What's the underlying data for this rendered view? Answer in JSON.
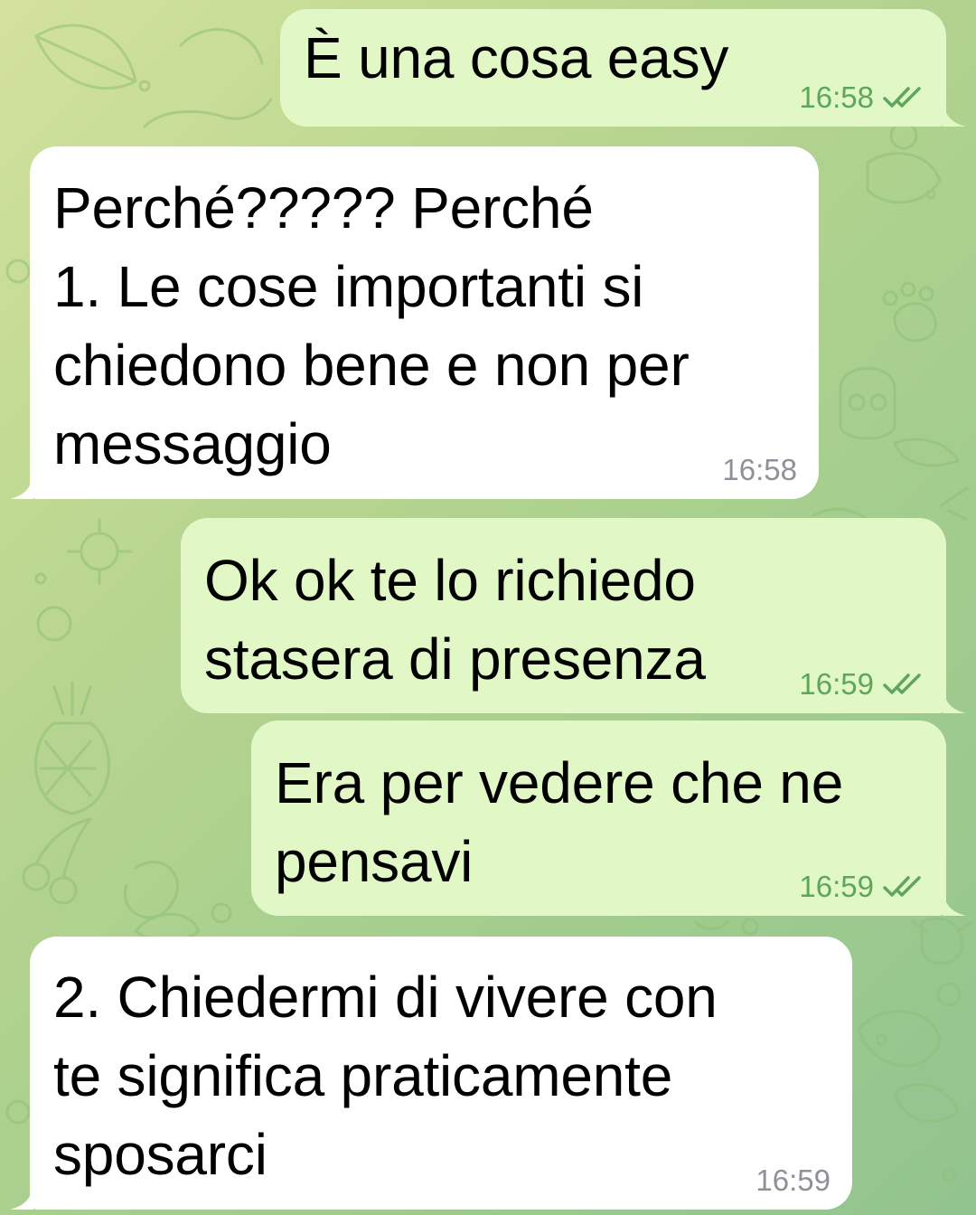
{
  "theme": {
    "outgoing_bubble": "#e1f7c6",
    "incoming_bubble": "#ffffff",
    "outgoing_meta": "#5fa65d",
    "incoming_meta": "#8e9198",
    "background_start": "#d3e29c",
    "background_end": "#92c48f"
  },
  "messages": [
    {
      "direction": "outgoing",
      "text": "È una cosa easy",
      "time": "16:58",
      "status": "read-double-check-icon"
    },
    {
      "direction": "incoming",
      "text": "Perché????? Perché\n1. Le cose importanti si\nchiedono bene e non per\nmessaggio",
      "time": "16:58"
    },
    {
      "direction": "outgoing",
      "text": "Ok ok te lo richiedo\nstasera di presenza",
      "time": "16:59",
      "status": "read-double-check-icon"
    },
    {
      "direction": "outgoing",
      "text": "Era per vedere che ne\npensavi",
      "time": "16:59",
      "status": "read-double-check-icon"
    },
    {
      "direction": "incoming",
      "text": "2. Chiedermi di vivere con\nte significa praticamente\nsposarci",
      "time": "16:59"
    }
  ]
}
